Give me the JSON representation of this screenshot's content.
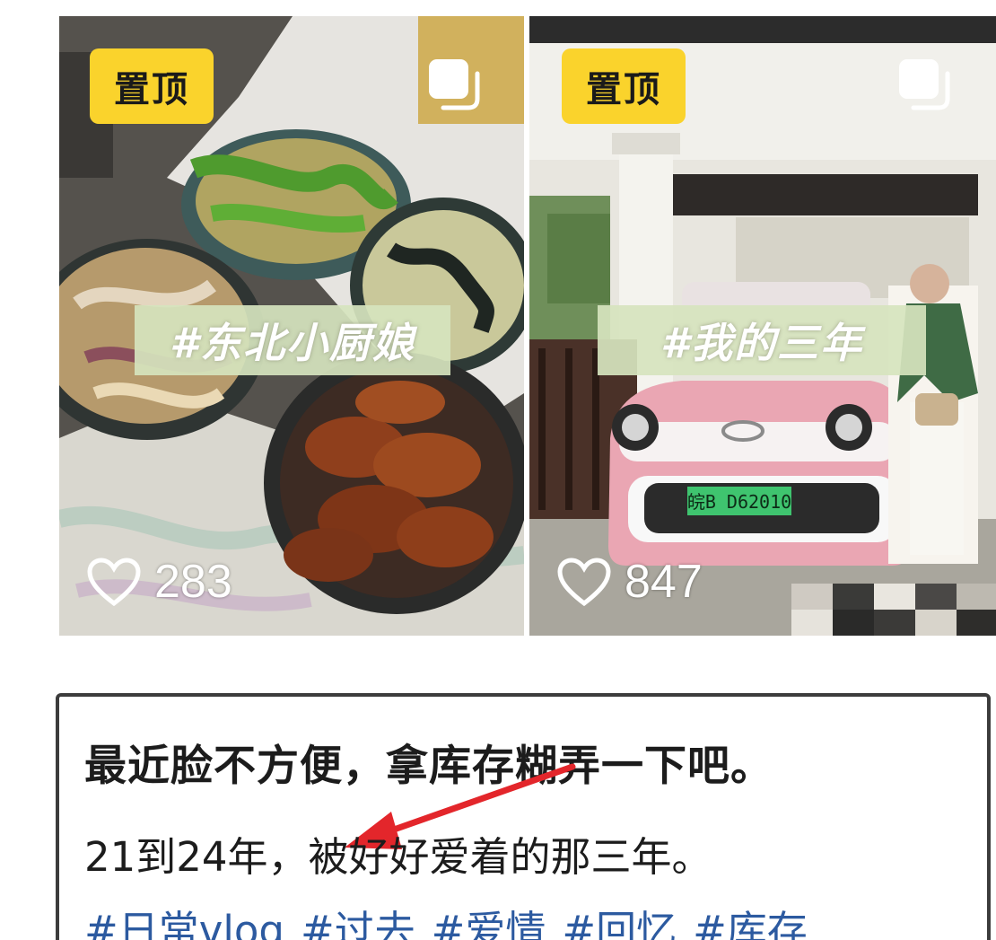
{
  "posts": [
    {
      "pin_label": "置顶",
      "tag": "#东北小厨娘",
      "likes": "283",
      "icons": {
        "pin": "pinned-badge",
        "multi": "multi-image-icon",
        "like": "heart-outline-icon"
      }
    },
    {
      "pin_label": "置顶",
      "tag": "#我的三年",
      "likes": "847",
      "plate": "皖B D62010",
      "icons": {
        "pin": "pinned-badge",
        "multi": "multi-image-icon",
        "like": "heart-outline-icon"
      }
    }
  ],
  "caption": {
    "headline": "最近脸不方便，拿库存糊弄一下吧。",
    "subline": "21到24年，被好好爱着的那三年。",
    "hashtags": [
      "#日常vlog",
      "#过去",
      "#爱情",
      "#回忆",
      "#库存"
    ]
  },
  "colors": {
    "pin_badge": "#fad32c",
    "hashtag": "#2c5aa0",
    "annotation_arrow": "#e3262b",
    "tag_pill": "#d6e4be"
  }
}
